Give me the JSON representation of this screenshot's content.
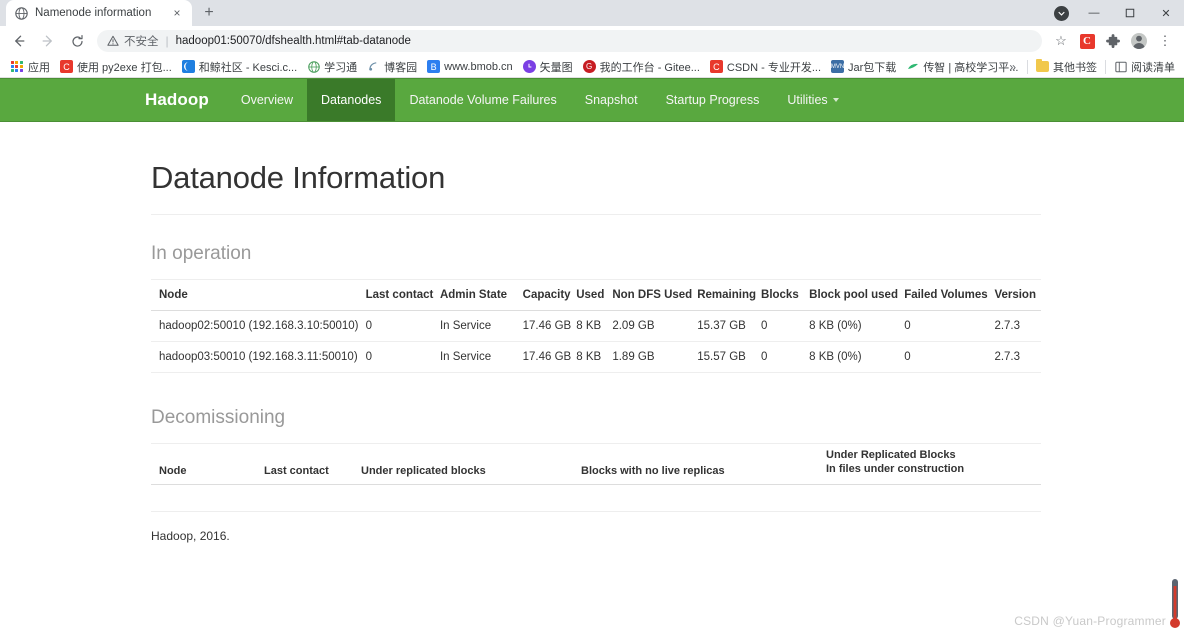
{
  "browser": {
    "tab": {
      "title": "Namenode information",
      "favicon": "globe-icon",
      "close": "×"
    },
    "new_tab": "+",
    "window_controls": {
      "menu": "▼",
      "minimize": "—",
      "maximize": "❐",
      "close": "✕"
    },
    "toolbar": {
      "back": "←",
      "forward": "→",
      "reload": "⟳",
      "security_label": "不安全",
      "security_icon": "warning-triangle-icon",
      "url": "hadoop01:50070/dfshealth.html#tab-datanode",
      "star": "☆",
      "extension_csdn": "C",
      "extensions": "❖",
      "profile": "●",
      "menu": "⋮"
    },
    "bookmarks": {
      "apps_label": "应用",
      "items": [
        {
          "label": "使用 py2exe 打包...",
          "icon_text": "C",
          "icon_color": "#e8382c"
        },
        {
          "label": "和鲸社区 - Kesci.c...",
          "icon_text": "",
          "icon_color": "#1f7fe0"
        },
        {
          "label": "学习通",
          "icon_text": "",
          "icon_color": "#4a9e5c"
        },
        {
          "label": "博客园",
          "icon_text": "",
          "icon_color": "#6d8fa8"
        },
        {
          "label": "www.bmob.cn",
          "icon_text": "B",
          "icon_color": "#2d7ff0"
        },
        {
          "label": "矢量图",
          "icon_text": "",
          "icon_color": "#7b3fe4"
        },
        {
          "label": "我的工作台 - Gitee...",
          "icon_text": "",
          "icon_color": "#c71d23"
        },
        {
          "label": "CSDN - 专业开发...",
          "icon_text": "C",
          "icon_color": "#e8382c"
        },
        {
          "label": "Jar包下载",
          "icon_text": "",
          "icon_color": "#3c6ea5"
        },
        {
          "label": "传智 | 高校学习平...",
          "icon_text": "",
          "icon_color": "#2eb872"
        }
      ],
      "overflow": "»",
      "other_bookmarks": "其他书签",
      "reading_list": "阅读清单"
    }
  },
  "hadoop": {
    "brand": "Hadoop",
    "nav": [
      {
        "label": "Overview",
        "active": false,
        "caret": false
      },
      {
        "label": "Datanodes",
        "active": true,
        "caret": false
      },
      {
        "label": "Datanode Volume Failures",
        "active": false,
        "caret": false
      },
      {
        "label": "Snapshot",
        "active": false,
        "caret": false
      },
      {
        "label": "Startup Progress",
        "active": false,
        "caret": false
      },
      {
        "label": "Utilities",
        "active": false,
        "caret": true
      }
    ],
    "page_title": "Datanode Information",
    "in_operation": {
      "heading": "In operation",
      "columns": [
        "Node",
        "Last contact",
        "Admin State",
        "Capacity",
        "Used",
        "Non DFS Used",
        "Remaining",
        "Blocks",
        "Block pool used",
        "Failed Volumes",
        "Version"
      ],
      "rows": [
        {
          "node": "hadoop02:50010 (192.168.3.10:50010)",
          "last_contact": "0",
          "admin_state": "In Service",
          "capacity": "17.46 GB",
          "used": "8 KB",
          "non_dfs_used": "2.09 GB",
          "remaining": "15.37 GB",
          "blocks": "0",
          "block_pool_used": "8 KB (0%)",
          "failed_volumes": "0",
          "version": "2.7.3"
        },
        {
          "node": "hadoop03:50010 (192.168.3.11:50010)",
          "last_contact": "0",
          "admin_state": "In Service",
          "capacity": "17.46 GB",
          "used": "8 KB",
          "non_dfs_used": "1.89 GB",
          "remaining": "15.57 GB",
          "blocks": "0",
          "block_pool_used": "8 KB (0%)",
          "failed_volumes": "0",
          "version": "2.7.3"
        }
      ]
    },
    "decommissioning": {
      "heading": "Decomissioning",
      "columns": {
        "node": "Node",
        "last_contact": "Last contact",
        "under_replicated": "Under replicated blocks",
        "no_live_replicas": "Blocks with no live replicas",
        "under_replicated_files_line1": "Under Replicated Blocks",
        "under_replicated_files_line2": "In files under construction"
      },
      "rows": []
    },
    "footer": "Hadoop, 2016."
  },
  "watermark": "CSDN @Yuan-Programmer"
}
